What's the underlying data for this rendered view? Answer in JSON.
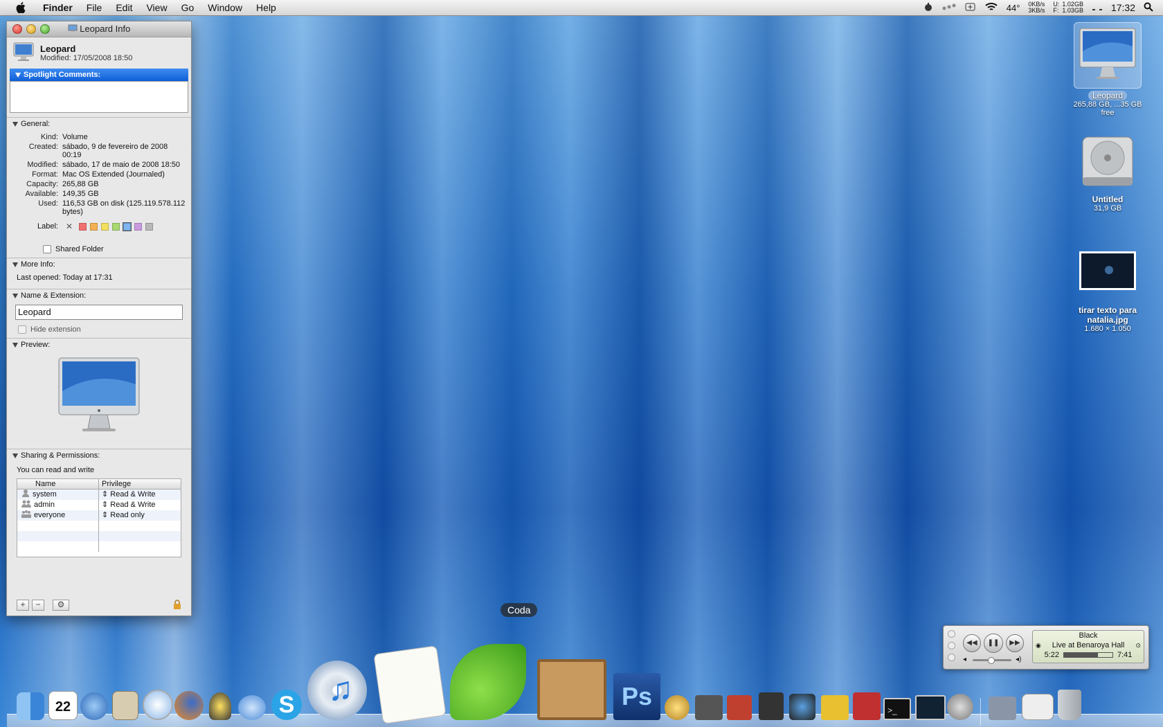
{
  "menubar": {
    "app": "Finder",
    "items": [
      "File",
      "Edit",
      "View",
      "Go",
      "Window",
      "Help"
    ],
    "temp": "44°",
    "net_down": "0KB/s",
    "net_up": "3KB/s",
    "disk_u_label": "U:",
    "disk_u": "1.02GB",
    "disk_f_label": "F:",
    "disk_f": "1.03GB",
    "clock": "17:32"
  },
  "info": {
    "window_title": "Leopard Info",
    "name": "Leopard",
    "modified_short": "Modified: 17/05/2008 18:50",
    "spotlight_header": "Spotlight Comments:",
    "general_header": "General:",
    "general": [
      {
        "k": "Kind:",
        "v": "Volume"
      },
      {
        "k": "Created:",
        "v": "sábado, 9 de fevereiro de 2008 00:19"
      },
      {
        "k": "Modified:",
        "v": "sábado, 17 de maio de 2008 18:50"
      },
      {
        "k": "Format:",
        "v": "Mac OS Extended (Journaled)"
      },
      {
        "k": "Capacity:",
        "v": "265,88 GB"
      },
      {
        "k": "Available:",
        "v": "149,35 GB"
      },
      {
        "k": "Used:",
        "v": "116,53 GB on disk (125.119.578.112 bytes)"
      }
    ],
    "label_text": "Label:",
    "label_colors": [
      "#f07070",
      "#f5b055",
      "#f2e060",
      "#a8d870",
      "#7fb5f0",
      "#c89ae0",
      "#b8b8b8"
    ],
    "shared_folder": "Shared Folder",
    "more_info_header": "More Info:",
    "last_opened": "Last opened: Today at 17:31",
    "name_ext_header": "Name & Extension:",
    "name_value": "Leopard",
    "hide_extension": "Hide extension",
    "preview_header": "Preview:",
    "sharing_header": "Sharing & Permissions:",
    "sharing_status": "You can read and write",
    "perm_cols": [
      "Name",
      "Privilege"
    ],
    "perms": [
      {
        "name": "system",
        "priv": "Read & Write"
      },
      {
        "name": "admin",
        "priv": "Read & Write"
      },
      {
        "name": "everyone",
        "priv": "Read only"
      }
    ]
  },
  "desktop": {
    "leopard": {
      "label": "Leopard",
      "sub": "265,88 GB, ...35 GB free"
    },
    "untitled": {
      "label": "Untitled",
      "sub": "31,9 GB"
    },
    "jpg": {
      "label": "tirar texto para natalia.jpg",
      "sub": "1.680 × 1.050"
    }
  },
  "itunes": {
    "track": "Black",
    "album": "Live at Benaroya Hall",
    "elapsed": "5:22",
    "total": "7:41",
    "progress": 0.7
  },
  "dock": {
    "tooltip": "Coda",
    "calendar_day": "22"
  }
}
